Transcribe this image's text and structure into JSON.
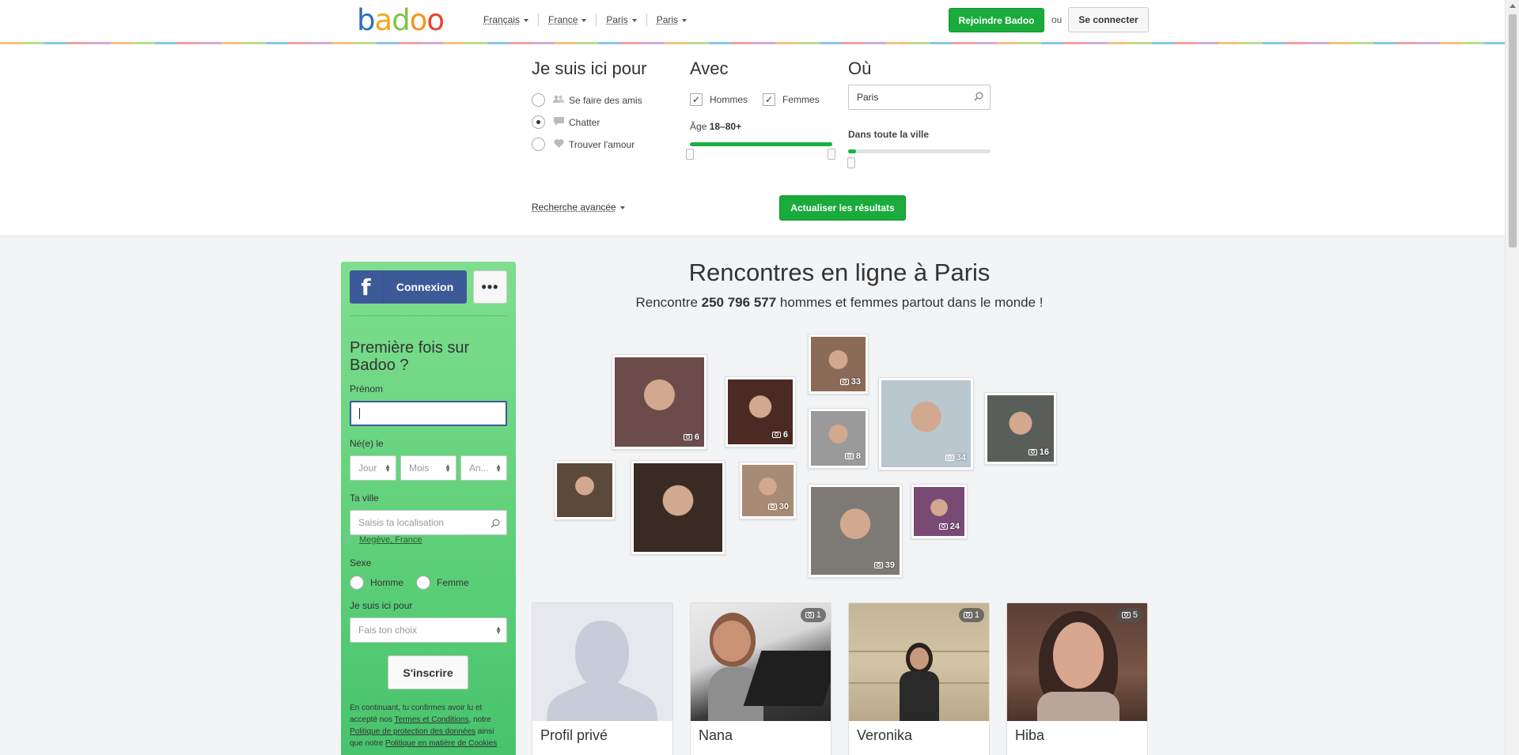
{
  "header": {
    "logo_text": "badoo",
    "nav": [
      {
        "label": "Français"
      },
      {
        "label": "France"
      },
      {
        "label": "Paris"
      },
      {
        "label": "Paris"
      }
    ],
    "join_button": "Rejoindre Badoo",
    "or_text": "ou",
    "login_button": "Se connecter"
  },
  "filters": {
    "purpose_title": "Je suis ici pour",
    "purpose_options": [
      {
        "label": "Se faire des amis",
        "icon": "people-icon",
        "selected": false
      },
      {
        "label": "Chatter",
        "icon": "chat-bubble-icon",
        "selected": true
      },
      {
        "label": "Trouver l'amour",
        "icon": "heart-icon",
        "selected": false
      }
    ],
    "with_title": "Avec",
    "men_label": "Hommes",
    "women_label": "Femmes",
    "men_checked": true,
    "women_checked": true,
    "age_prefix": "Âge",
    "age_range": "18–80+",
    "age_min": 18,
    "age_max": 80,
    "where_title": "Où",
    "city_value": "Paris",
    "distance_label": "Dans toute la ville",
    "distance_level": 0.05,
    "advanced_search": "Recherche avancée",
    "update_button": "Actualiser les résultats",
    "accent_color": "#1aab3c"
  },
  "signup": {
    "fb_icon": "f",
    "fb_button": "Connexion",
    "more_button": "•••",
    "title": "Première fois sur Badoo ?",
    "firstname_label": "Prénom",
    "firstname_value": "",
    "birth_label": "Né(e) le",
    "day_placeholder": "Jour",
    "month_placeholder": "Mois",
    "year_placeholder": "An...",
    "city_label": "Ta ville",
    "city_placeholder": "Saisis ta localisation",
    "location_suggestion": "Megève, France",
    "sex_label": "Sexe",
    "male_label": "Homme",
    "female_label": "Femme",
    "purpose_label": "Je suis ici pour",
    "purpose_placeholder": "Fais ton choix",
    "submit_button": "S'inscrire",
    "legal_1": "En continuant, tu confirmes avoir lu et accepté nos ",
    "legal_terms": "Termes et Conditions",
    "legal_2": ", notre ",
    "legal_privacy": "Politique de protection des données",
    "legal_3": " ainsi que notre ",
    "legal_cookies": "Politique en matière de Cookies"
  },
  "main": {
    "title": "Rencontres en ligne à Paris",
    "subtitle_prefix": "Rencontre ",
    "member_count": "250 796 577",
    "subtitle_suffix": " hommes et femmes partout dans le monde !",
    "photo_cloud": [
      {
        "count": "6",
        "bg": "#6b4c4a"
      },
      {
        "count": "6",
        "bg": "#4a2a22"
      },
      {
        "count": "33",
        "bg": "#8c6a58"
      },
      {
        "count": "8",
        "bg": "#9a9a9a"
      },
      {
        "count": "34",
        "bg": "#b9c7cf"
      },
      {
        "count": "16",
        "bg": "#5a5e5a"
      },
      {
        "count": "",
        "bg": "#5b4a3c"
      },
      {
        "count": "",
        "bg": "#3a2a24"
      },
      {
        "count": "30",
        "bg": "#a88b75"
      },
      {
        "count": "39",
        "bg": "#7d7a75"
      },
      {
        "count": "24",
        "bg": "#7a4a76"
      }
    ],
    "profiles": [
      {
        "name": "Profil privé",
        "photos": ""
      },
      {
        "name": "Nana",
        "photos": "1"
      },
      {
        "name": "Veronika",
        "photos": "1"
      },
      {
        "name": "Hiba",
        "photos": "5"
      }
    ]
  }
}
